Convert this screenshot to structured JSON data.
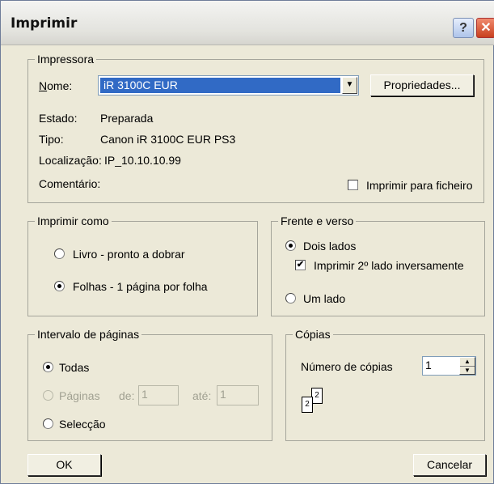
{
  "window": {
    "title": "Imprimir",
    "help_glyph": "?",
    "close_glyph": "✕"
  },
  "printer": {
    "legend": "Impressora",
    "name_label": "Nome:",
    "name_value": "iR 3100C EUR",
    "properties_button": "Propriedades...",
    "status_label": "Estado:",
    "status_value": "Preparada",
    "type_label": "Tipo:",
    "type_value": "Canon iR 3100C EUR PS3",
    "location_label": "Localização:",
    "location_value": "IP_10.10.10.99",
    "comment_label": "Comentário:",
    "print_to_file_label": "Imprimir para ficheiro",
    "print_to_file_checked": false
  },
  "print_as": {
    "legend": "Imprimir como",
    "option_booklet": "Livro - pronto a dobrar",
    "option_sheets": "Folhas - 1 página por folha",
    "selected": "sheets"
  },
  "duplex": {
    "legend": "Frente e verso",
    "option_two_sides": "Dois lados",
    "reverse_second_side_label": "Imprimir 2º lado inversamente",
    "reverse_second_side_checked": true,
    "option_one_side": "Um lado",
    "selected": "two_sides"
  },
  "page_range": {
    "legend": "Intervalo de páginas",
    "option_all": "Todas",
    "option_pages": "Páginas",
    "from_label": "de:",
    "from_value": "1",
    "to_label": "até:",
    "to_value": "1",
    "option_selection": "Selecção",
    "selected": "all"
  },
  "copies": {
    "legend": "Cópias",
    "count_label": "Número de cópias",
    "count_value": "1",
    "collate_pages": [
      "2",
      "2"
    ]
  },
  "buttons": {
    "ok": "OK",
    "cancel": "Cancelar"
  }
}
